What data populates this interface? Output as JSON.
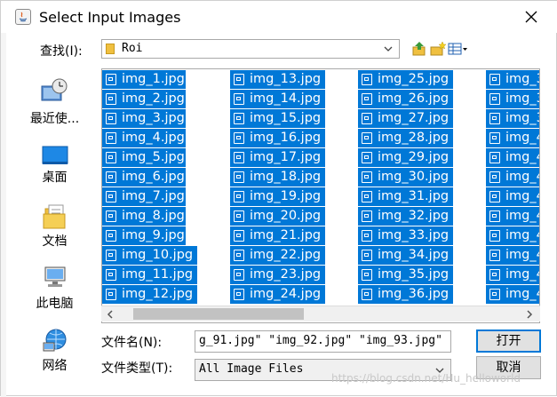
{
  "window": {
    "title": "Select Input Images"
  },
  "lookin": {
    "label": "查找(I):",
    "value": "Roi"
  },
  "places": [
    {
      "label": "最近使...",
      "icon": "recent-icon"
    },
    {
      "label": "桌面",
      "icon": "desktop-icon"
    },
    {
      "label": "文档",
      "icon": "documents-icon"
    },
    {
      "label": "此电脑",
      "icon": "computer-icon"
    },
    {
      "label": "网络",
      "icon": "network-icon"
    }
  ],
  "files": {
    "col1": [
      "img_1.jpg",
      "img_2.jpg",
      "img_3.jpg",
      "img_4.jpg",
      "img_5.jpg",
      "img_6.jpg",
      "img_7.jpg",
      "img_8.jpg",
      "img_9.jpg",
      "img_10.jpg",
      "img_11.jpg",
      "img_12.jpg"
    ],
    "col2": [
      "img_13.jpg",
      "img_14.jpg",
      "img_15.jpg",
      "img_16.jpg",
      "img_17.jpg",
      "img_18.jpg",
      "img_19.jpg",
      "img_20.jpg",
      "img_21.jpg",
      "img_22.jpg",
      "img_23.jpg",
      "img_24.jpg"
    ],
    "col3": [
      "img_25.jpg",
      "img_26.jpg",
      "img_27.jpg",
      "img_28.jpg",
      "img_29.jpg",
      "img_30.jpg",
      "img_31.jpg",
      "img_32.jpg",
      "img_33.jpg",
      "img_34.jpg",
      "img_35.jpg",
      "img_36.jpg"
    ],
    "col4": [
      "img_3",
      "img_3",
      "img_3",
      "img_4",
      "img_4",
      "img_4",
      "img_4",
      "img_4",
      "img_4",
      "img_4",
      "img_4",
      "img_4"
    ]
  },
  "filename": {
    "label": "文件名(N):",
    "value": "g_91.jpg\" \"img_92.jpg\" \"img_93.jpg\""
  },
  "filetype": {
    "label": "文件类型(T):",
    "value": "All Image Files"
  },
  "buttons": {
    "open": "打开",
    "cancel": "取消"
  },
  "watermark": "https://blog.csdn.net/Hu_helloworld",
  "colors": {
    "selection": "#0078d7",
    "primary_border": "#0078d7"
  }
}
